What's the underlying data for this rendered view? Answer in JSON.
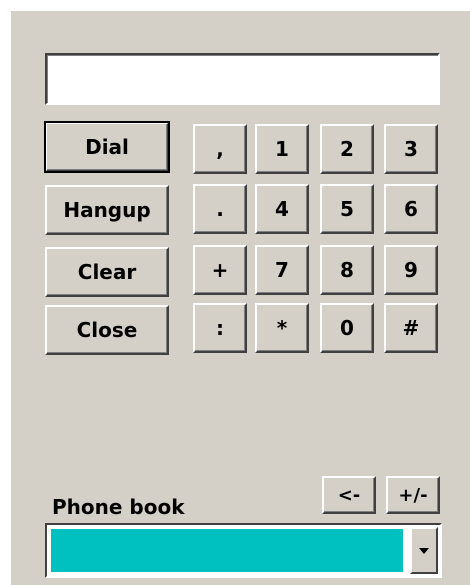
{
  "display": {
    "value": ""
  },
  "actions": {
    "dial": "Dial",
    "hangup": "Hangup",
    "clear": "Clear",
    "close": "Close"
  },
  "keypad": {
    "row1": [
      ",",
      "1",
      "2",
      "3"
    ],
    "row2": [
      ".",
      "4",
      "5",
      "6"
    ],
    "row3": [
      "+",
      "7",
      "8",
      "9"
    ],
    "row4": [
      ":",
      "*",
      "0",
      "#"
    ]
  },
  "edit": {
    "backspace": "<-",
    "plus_minus": "+/-"
  },
  "phonebook": {
    "label": "Phone book",
    "selected": ""
  },
  "colors": {
    "face": "#d4d0c8",
    "combo_fill": "#00c0c0"
  },
  "icons": {
    "dropdown": "chevron-down-icon"
  }
}
